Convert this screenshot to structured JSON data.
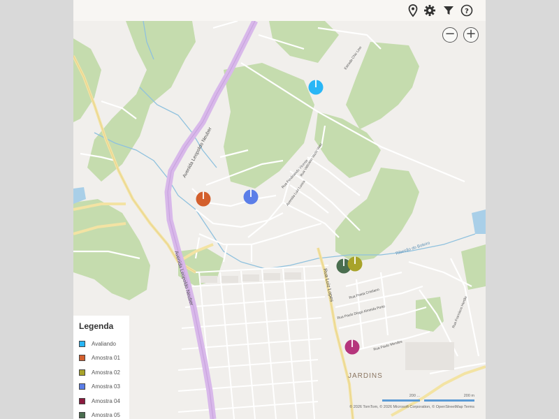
{
  "toolbar": {
    "icons": [
      "map-pin-icon",
      "gear-icon",
      "filter-icon",
      "help-icon"
    ]
  },
  "zoom": {
    "out_label": "−",
    "in_label": "+"
  },
  "map": {
    "road_labels": {
      "avenue_north": "Avenida Leopoldo Neuber",
      "avenue_south": "Avenida Leopoldo Neuber",
      "rua_luiz": "Rua Luiz Lopes",
      "rua_a": "Rua Vaticano Vazio Vasc",
      "rua_b": "Avenida Luiz Lusca",
      "rua_c": "Rua Ferdinando Vicente",
      "rua_d": "Rua Paulo Diogo Almeida Porto",
      "rua_e": "Rua Poeta Cristiano",
      "rua_f": "Rua Paulo Mendes",
      "estrada": "Estrada Chic Lino",
      "river": "Ribeirão do Boleiro",
      "east": "Rua Francisco Hertão"
    },
    "place_label": "JARDINS",
    "attribution": "© 2026 TomTom, © 2026 Microsoft Corporation, © OpenStreetMap Terms",
    "scale": {
      "left_label": "200 ...",
      "right_label": "200 m"
    }
  },
  "markers": [
    {
      "name": "Avaliando",
      "color": "#29b6f6"
    },
    {
      "name": "Amostra 01",
      "color": "#d35f2d"
    },
    {
      "name": "Amostra 03",
      "color": "#5b7ee8"
    },
    {
      "name": "Amostra 05",
      "color": "#4a6e4f"
    },
    {
      "name": "Amostra 02",
      "color": "#a8a32a"
    },
    {
      "name": "Amostra 04",
      "color": "#b5357c"
    }
  ],
  "legend": {
    "title": "Legenda",
    "items": [
      {
        "label": "Avaliando",
        "color": "#29b6f6"
      },
      {
        "label": "Amostra 01",
        "color": "#d35f2d"
      },
      {
        "label": "Amostra 02",
        "color": "#a8a32a"
      },
      {
        "label": "Amostra 03",
        "color": "#5b7ee8"
      },
      {
        "label": "Amostra 04",
        "color": "#8b1a3e"
      },
      {
        "label": "Amostra 05",
        "color": "#4a6e4f"
      }
    ]
  }
}
